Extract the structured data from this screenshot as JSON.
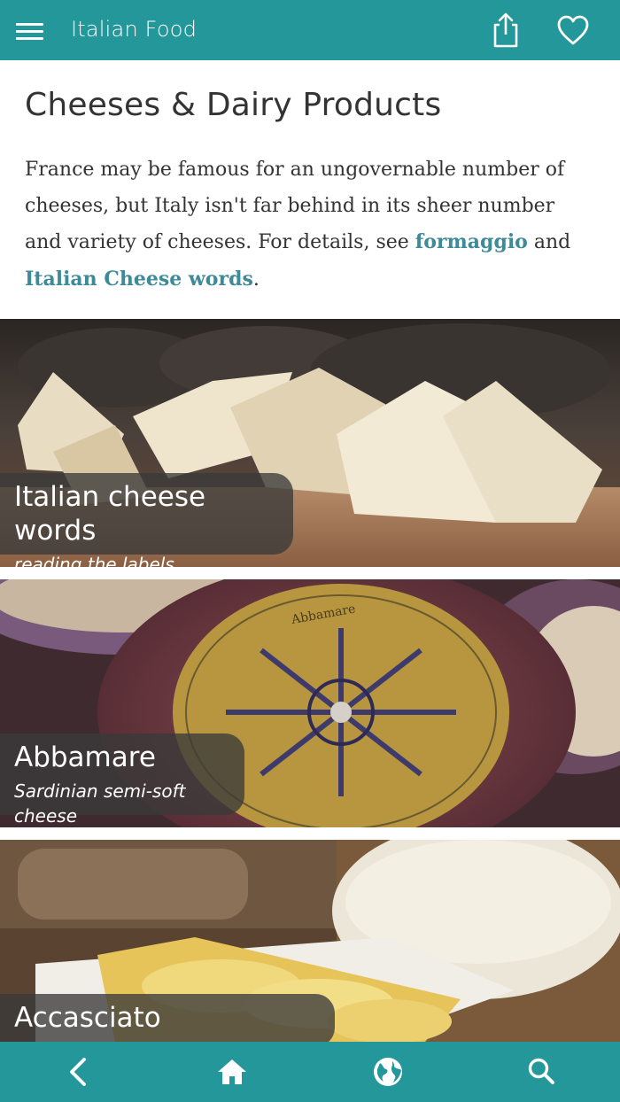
{
  "header": {
    "title": "Italian Food",
    "menu_icon": "hamburger-menu-icon",
    "share_icon": "share-icon",
    "favorite_icon": "heart-icon"
  },
  "page": {
    "title": "Cheeses & Dairy Products",
    "intro_part1": "France may be famous for an ungovernable number of cheeses, but Italy isn't far behind in its sheer number and variety of cheeses. For details, see ",
    "link1": "formaggio",
    "intro_part2": " and ",
    "link2": "Italian Cheese words",
    "intro_part3": "."
  },
  "cards": [
    {
      "title": "Italian cheese words",
      "subtitle": "reading the labels"
    },
    {
      "title": "Abbamare",
      "subtitle": "Sardinian semi-soft cheese"
    },
    {
      "title": "Accasciato",
      "subtitle": ""
    }
  ],
  "bottom_nav": [
    {
      "icon": "back-icon"
    },
    {
      "icon": "home-icon"
    },
    {
      "icon": "globe-icon"
    },
    {
      "icon": "search-icon"
    }
  ],
  "colors": {
    "accent": "#23979a",
    "link": "#3d8a99",
    "text": "#333333"
  }
}
